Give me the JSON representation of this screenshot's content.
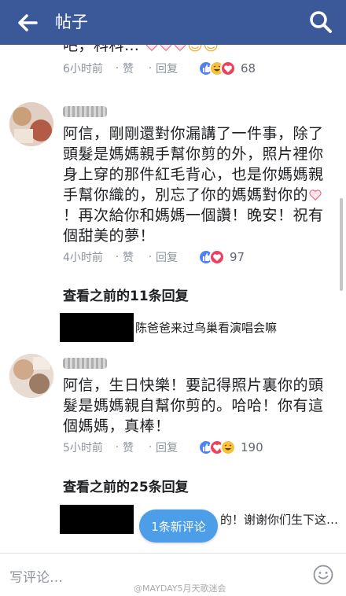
{
  "header": {
    "title": "帖子",
    "back_icon": "arrow-left-icon",
    "search_icon": "search-icon",
    "bg_color": "#3b5998"
  },
  "top_partial": {
    "text": "吧，科科…",
    "time": "6小时前",
    "like_label": "赞",
    "reply_label": "回复",
    "reaction_count": "68",
    "reactions": [
      "like",
      "haha",
      "love"
    ]
  },
  "comments": [
    {
      "text_before_heart": "阿信，剛剛還對你漏講了一件事，除了頭髮是媽媽親手幫你剪的外，照片裡你身上穿的那件紅毛背心，也是你媽媽親手幫你織的，別忘了你的媽媽對你的",
      "text_after_heart": "！再次給你和媽媽一個讚！晚安！祝有個甜美的夢！",
      "time": "4小时前",
      "like_label": "赞",
      "reply_label": "回复",
      "reactions": [
        "like",
        "love"
      ],
      "reaction_count": "97",
      "view_previous": "查看之前的11条回复",
      "reply_preview": "陈爸爸来过鸟巢看演唱会嘛"
    },
    {
      "text": "阿信，生日快樂！要記得照片裏你的頭髮是媽媽親自幫你剪的。哈哈！你有這個媽媽，真棒！",
      "time": "5小时前",
      "like_label": "赞",
      "reply_label": "回复",
      "reactions": [
        "like",
        "love",
        "haha"
      ],
      "reaction_count": "190",
      "view_previous": "查看之前的25条回复",
      "reply_preview": "的！谢谢你们生下这…"
    }
  ],
  "new_comment_pill": "1条新评论",
  "composer": {
    "placeholder": "写评论…",
    "emoji_icon": "smiley-face-icon"
  },
  "watermark": "@MAYDAY5月天歌迷会"
}
